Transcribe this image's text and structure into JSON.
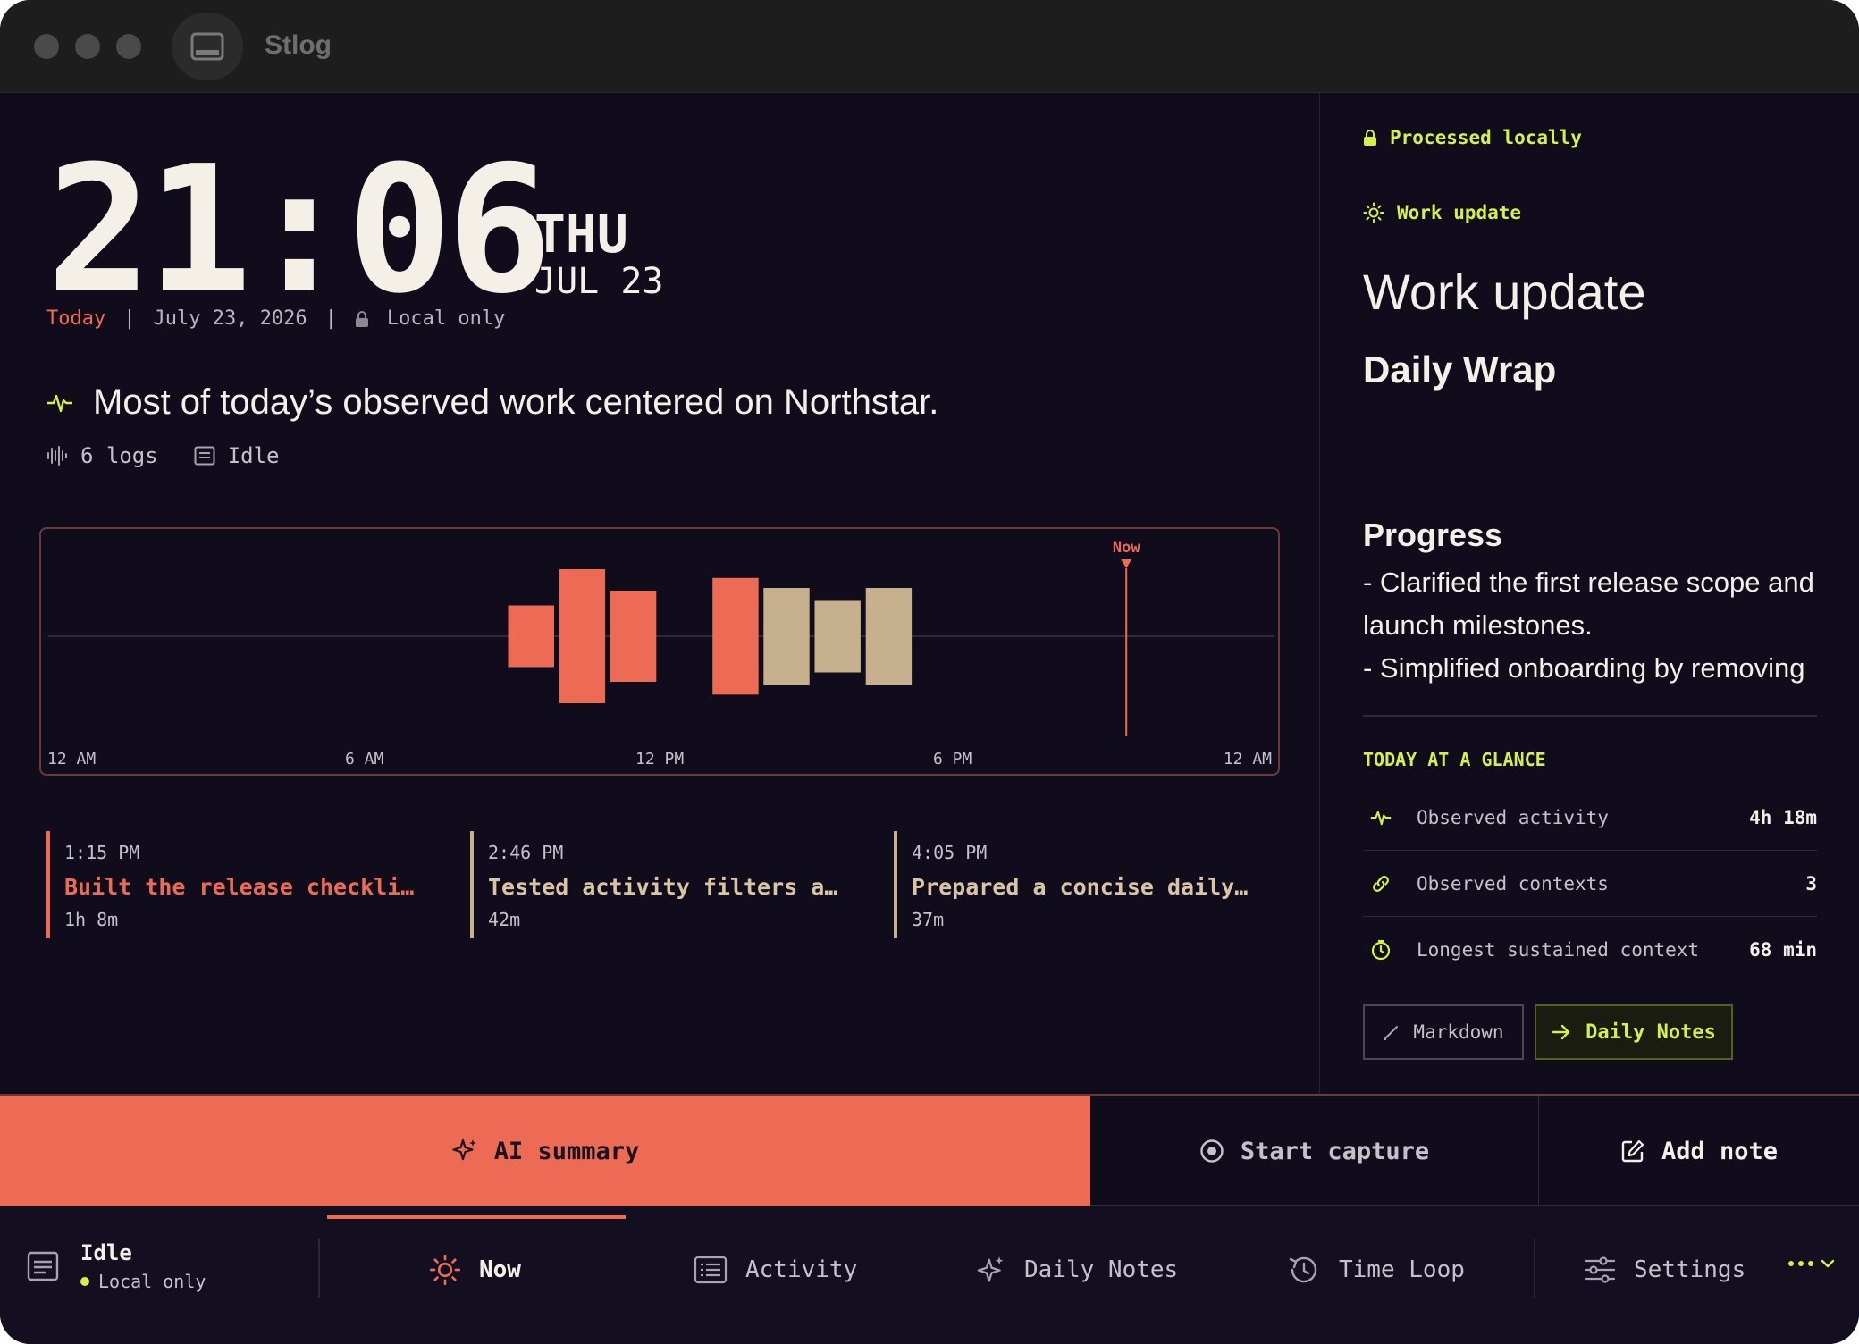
{
  "app": {
    "title": "Stlog"
  },
  "clock": {
    "time": "21:06",
    "day_of_week": "THU",
    "month_day": "JUL 23"
  },
  "date_row": {
    "today_label": "Today",
    "full_date": "July 23, 2026",
    "privacy": "Local only"
  },
  "headline": {
    "text": "Most of today’s observed work centered on Northstar."
  },
  "meta": {
    "logs": "6 logs",
    "status": "Idle"
  },
  "chart_data": {
    "type": "bar",
    "x_axis": {
      "ticks": [
        "12 AM",
        "6 AM",
        "12 PM",
        "6 PM",
        "12 AM"
      ],
      "range_hours": [
        0,
        24
      ]
    },
    "now_marker": {
      "label": "Now",
      "hour": 21.1
    },
    "bars": [
      {
        "start_hour": 9.0,
        "end_hour": 9.9,
        "intensity": 0.46,
        "color": "#ed6a55"
      },
      {
        "start_hour": 10.0,
        "end_hour": 10.9,
        "intensity": 1.0,
        "color": "#ed6a55"
      },
      {
        "start_hour": 11.0,
        "end_hour": 11.9,
        "intensity": 0.68,
        "color": "#ed6a55"
      },
      {
        "start_hour": 13.0,
        "end_hour": 13.9,
        "intensity": 0.87,
        "color": "#ed6a55"
      },
      {
        "start_hour": 14.0,
        "end_hour": 14.9,
        "intensity": 0.72,
        "color": "#c7b08e"
      },
      {
        "start_hour": 15.0,
        "end_hour": 15.9,
        "intensity": 0.54,
        "color": "#c7b08e"
      },
      {
        "start_hour": 16.0,
        "end_hour": 16.9,
        "intensity": 0.72,
        "color": "#c7b08e"
      }
    ]
  },
  "entries": [
    {
      "time": "1:15 PM",
      "title": "Built the release checkli…",
      "duration": "1h 8m",
      "color": "#ed6a55"
    },
    {
      "time": "2:46 PM",
      "title": "Tested activity filters a…",
      "duration": "42m",
      "color": "#c7b08e"
    },
    {
      "time": "4:05 PM",
      "title": "Prepared a concise daily…",
      "duration": "37m",
      "color": "#c7b08e"
    }
  ],
  "right_panel": {
    "processed_badge": "Processed locally",
    "section_badge": "Work update",
    "title": "Work update",
    "subtitle": "Daily Wrap",
    "progress_heading": "Progress",
    "progress_lines": [
      "- Clarified the first release scope and",
      "launch milestones.",
      "- Simplified onboarding by removing"
    ],
    "glance_heading": "TODAY AT A GLANCE",
    "glance": [
      {
        "icon": "pulse-icon",
        "label": "Observed activity",
        "value": "4h 18m"
      },
      {
        "icon": "link-icon",
        "label": "Observed contexts",
        "value": "3"
      },
      {
        "icon": "timer-icon",
        "label": "Longest sustained context",
        "value": "68 min"
      }
    ],
    "markdown_button": "Markdown",
    "daily_notes_button": "Daily Notes"
  },
  "actions": {
    "ai_summary": "AI summary",
    "start_capture": "Start capture",
    "add_note": "Add note"
  },
  "status": {
    "state": "Idle",
    "privacy": "Local only"
  },
  "nav": {
    "now": "Now",
    "activity": "Activity",
    "daily_notes": "Daily Notes",
    "time_loop": "Time Loop",
    "settings": "Settings"
  },
  "colors": {
    "accent": "#ed6a55",
    "accent_secondary": "#c7b08e",
    "highlight": "#d6f04a",
    "background": "#100c1c"
  }
}
